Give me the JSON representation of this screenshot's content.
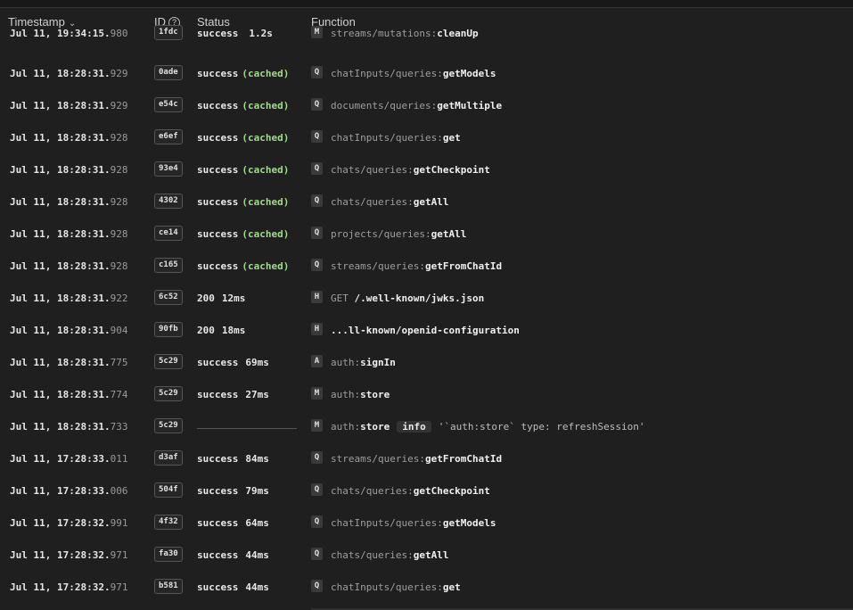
{
  "header": {
    "timestamp": "Timestamp",
    "id": "ID",
    "id_help": "?",
    "status": "Status",
    "function": "Function",
    "sort_icon": "chevron-down-icon"
  },
  "rows": [
    {
      "ts": "Jul 11, 19:34:15.",
      "ms": "980",
      "id": "1fdc",
      "status": "success",
      "cached": "",
      "dur": "1.2s",
      "type": "M",
      "path": "streams/mutations:",
      "name": "cleanUp",
      "info": "",
      "msg": ""
    },
    {
      "ts": "Jul 11, 18:28:31.",
      "ms": "929",
      "id": "0ade",
      "status": "success",
      "cached": "(cached)",
      "dur": "",
      "type": "Q",
      "path": "chatInputs/queries:",
      "name": "getModels",
      "info": "",
      "msg": ""
    },
    {
      "ts": "Jul 11, 18:28:31.",
      "ms": "929",
      "id": "e54c",
      "status": "success",
      "cached": "(cached)",
      "dur": "",
      "type": "Q",
      "path": "documents/queries:",
      "name": "getMultiple",
      "info": "",
      "msg": ""
    },
    {
      "ts": "Jul 11, 18:28:31.",
      "ms": "928",
      "id": "e6ef",
      "status": "success",
      "cached": "(cached)",
      "dur": "",
      "type": "Q",
      "path": "chatInputs/queries:",
      "name": "get",
      "info": "",
      "msg": ""
    },
    {
      "ts": "Jul 11, 18:28:31.",
      "ms": "928",
      "id": "93e4",
      "status": "success",
      "cached": "(cached)",
      "dur": "",
      "type": "Q",
      "path": "chats/queries:",
      "name": "getCheckpoint",
      "info": "",
      "msg": ""
    },
    {
      "ts": "Jul 11, 18:28:31.",
      "ms": "928",
      "id": "4302",
      "status": "success",
      "cached": "(cached)",
      "dur": "",
      "type": "Q",
      "path": "chats/queries:",
      "name": "getAll",
      "info": "",
      "msg": ""
    },
    {
      "ts": "Jul 11, 18:28:31.",
      "ms": "928",
      "id": "ce14",
      "status": "success",
      "cached": "(cached)",
      "dur": "",
      "type": "Q",
      "path": "projects/queries:",
      "name": "getAll",
      "info": "",
      "msg": ""
    },
    {
      "ts": "Jul 11, 18:28:31.",
      "ms": "928",
      "id": "c165",
      "status": "success",
      "cached": "(cached)",
      "dur": "",
      "type": "Q",
      "path": "streams/queries:",
      "name": "getFromChatId",
      "info": "",
      "msg": ""
    },
    {
      "ts": "Jul 11, 18:28:31.",
      "ms": "922",
      "id": "6c52",
      "status": "200",
      "cached": "",
      "dur": "12ms",
      "type": "H",
      "path": "GET ",
      "name": "/.well-known/jwks.json",
      "info": "",
      "msg": ""
    },
    {
      "ts": "Jul 11, 18:28:31.",
      "ms": "904",
      "id": "90fb",
      "status": "200",
      "cached": "",
      "dur": "18ms",
      "type": "H",
      "path": "",
      "name": "...ll-known/openid-configuration",
      "info": "",
      "msg": ""
    },
    {
      "ts": "Jul 11, 18:28:31.",
      "ms": "775",
      "id": "5c29",
      "status": "success",
      "cached": "",
      "dur": "69ms",
      "type": "A",
      "path": "auth:",
      "name": "signIn",
      "info": "",
      "msg": ""
    },
    {
      "ts": "Jul 11, 18:28:31.",
      "ms": "774",
      "id": "5c29",
      "status": "success",
      "cached": "",
      "dur": "27ms",
      "type": "M",
      "path": "auth:",
      "name": "store",
      "info": "",
      "msg": ""
    },
    {
      "ts": "Jul 11, 18:28:31.",
      "ms": "733",
      "id": "5c29",
      "status": "",
      "cached": "",
      "dur": "",
      "type": "M",
      "path": "auth:",
      "name": "store",
      "info": "info",
      "msg": "'`auth:store` type: refreshSession'"
    },
    {
      "ts": "Jul 11, 17:28:33.",
      "ms": "011",
      "id": "d3af",
      "status": "success",
      "cached": "",
      "dur": "84ms",
      "type": "Q",
      "path": "streams/queries:",
      "name": "getFromChatId",
      "info": "",
      "msg": ""
    },
    {
      "ts": "Jul 11, 17:28:33.",
      "ms": "006",
      "id": "504f",
      "status": "success",
      "cached": "",
      "dur": "79ms",
      "type": "Q",
      "path": "chats/queries:",
      "name": "getCheckpoint",
      "info": "",
      "msg": ""
    },
    {
      "ts": "Jul 11, 17:28:32.",
      "ms": "991",
      "id": "4f32",
      "status": "success",
      "cached": "",
      "dur": "64ms",
      "type": "Q",
      "path": "chatInputs/queries:",
      "name": "getModels",
      "info": "",
      "msg": ""
    },
    {
      "ts": "Jul 11, 17:28:32.",
      "ms": "971",
      "id": "fa30",
      "status": "success",
      "cached": "",
      "dur": "44ms",
      "type": "Q",
      "path": "chats/queries:",
      "name": "getAll",
      "info": "",
      "msg": ""
    },
    {
      "ts": "Jul 11, 17:28:32.",
      "ms": "971",
      "id": "b581",
      "status": "success",
      "cached": "",
      "dur": "44ms",
      "type": "Q",
      "path": "chatInputs/queries:",
      "name": "get",
      "info": "",
      "msg": ""
    }
  ]
}
